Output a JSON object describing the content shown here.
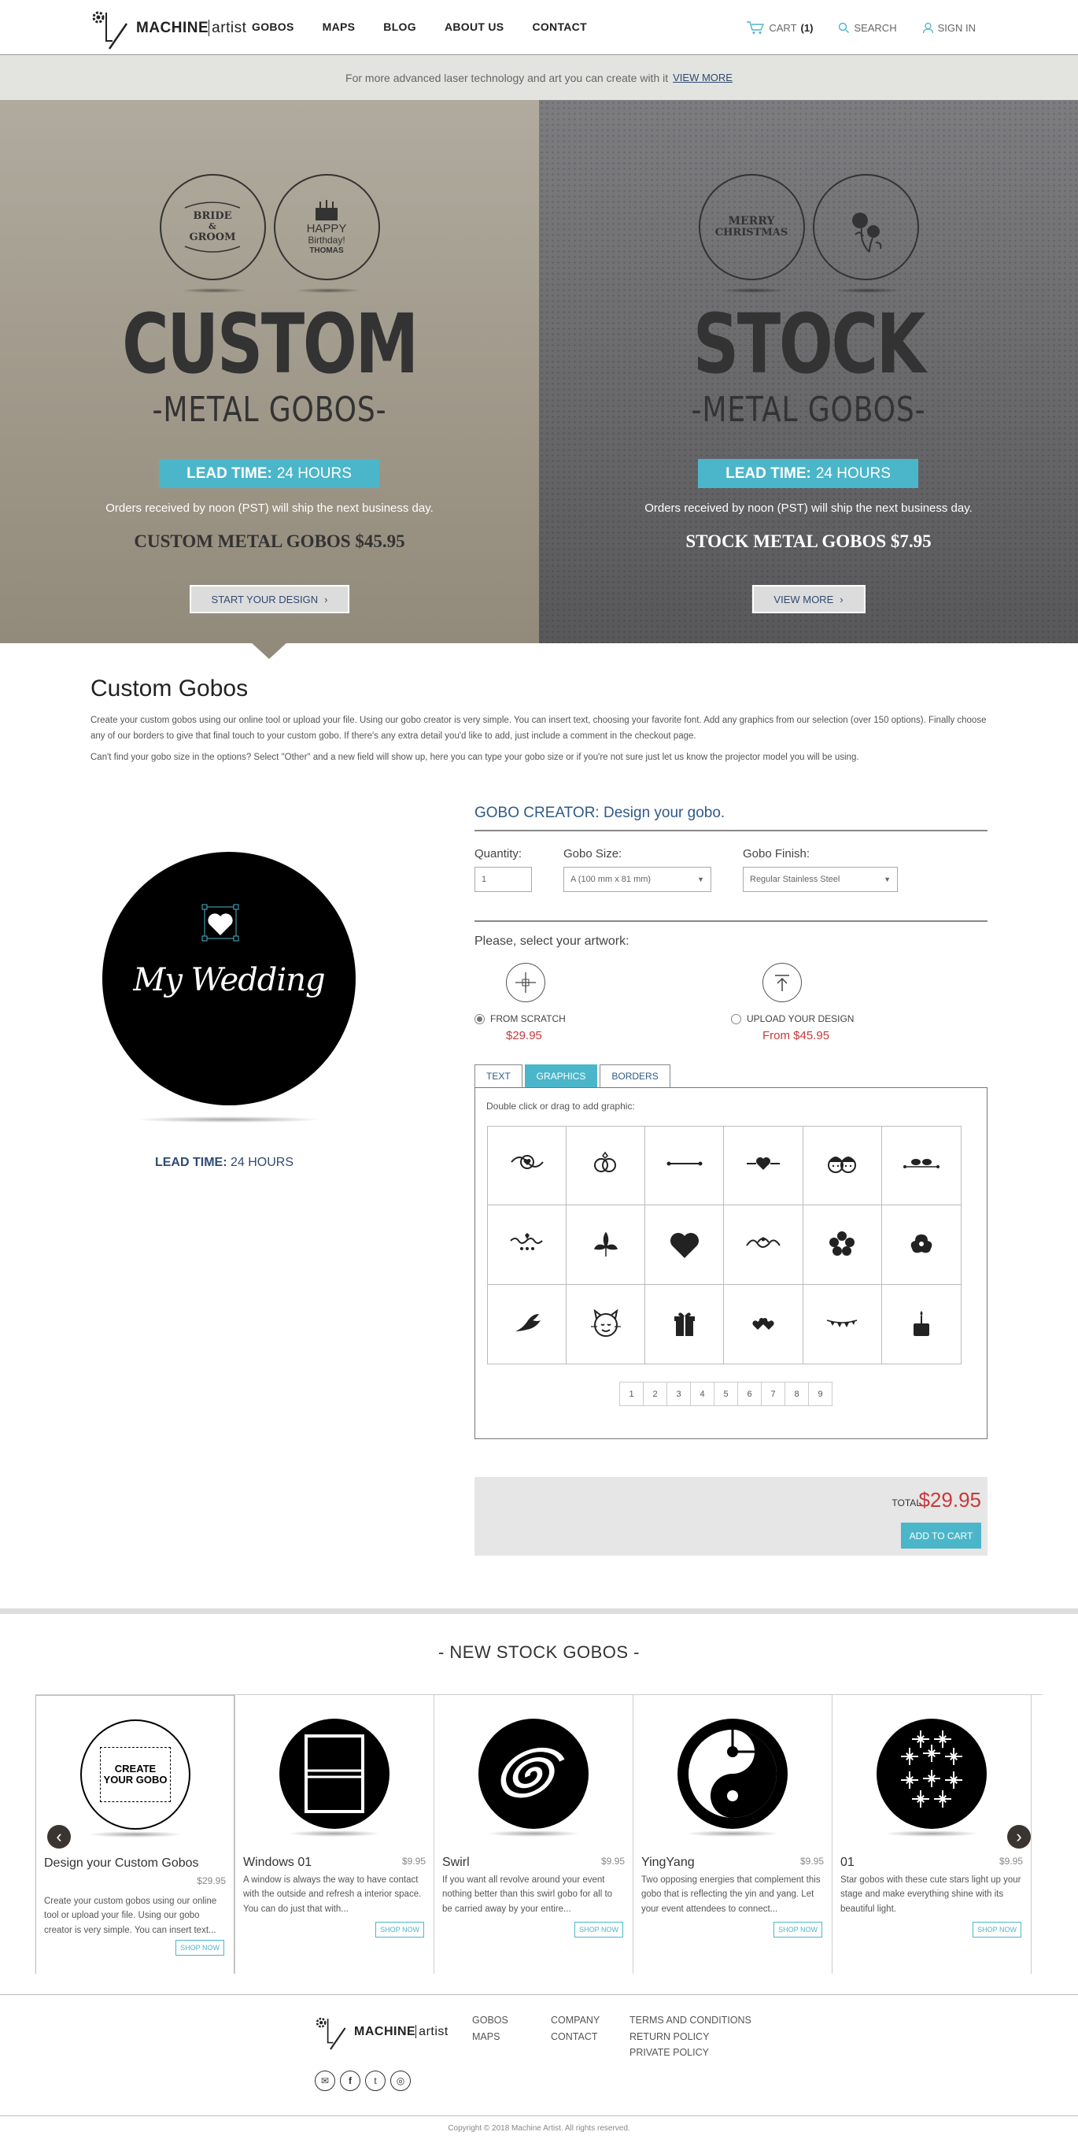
{
  "header": {
    "logo_bold": "MACHINE",
    "logo_light": "artist",
    "nav": [
      "GOBOS",
      "MAPS",
      "BLOG",
      "ABOUT US",
      "CONTACT"
    ],
    "cart_label": "CART",
    "cart_count": "(1)",
    "search_label": "SEARCH",
    "signin_label": "SIGN IN"
  },
  "promo": {
    "text": "For more advanced laser technology and art you can create with it",
    "link": "VIEW MORE"
  },
  "hero_left": {
    "seal1_line1": "BRIDE",
    "seal1_line2": "&",
    "seal1_line3": "GROOM",
    "seal2_line1": "HAPPY",
    "seal2_line2": "Birthday!",
    "seal2_line3": "THOMAS",
    "title": "CUSTOM",
    "subtitle": "-METAL GOBOS-",
    "lead_label": "LEAD TIME:",
    "lead_value": "24 HOURS",
    "shipping": "Orders received by noon (PST) will ship the next business day.",
    "price_label": "CUSTOM METAL GOBOS",
    "price": "$45.95",
    "button": "START YOUR DESIGN"
  },
  "hero_right": {
    "seal1_line1": "MERRY",
    "seal1_line2": "CHRISTMAS",
    "title": "STOCK",
    "subtitle": "-METAL GOBOS-",
    "lead_label": "LEAD TIME:",
    "lead_value": "24 HOURS",
    "shipping": "Orders received by noon (PST) will ship the next business day.",
    "price_label": "STOCK METAL GOBOS",
    "price": "$7.95",
    "button": "VIEW MORE"
  },
  "intro": {
    "title": "Custom Gobos",
    "p1": "Create your custom gobos using our online tool or upload your file. Using our gobo creator is very simple. You can insert text, choosing your favorite font. Add any graphics from our selection (over 150 options). Finally choose any of our borders to give that final touch to your custom gobo. If there's any extra detail you'd like to add, just include a comment in the checkout page.",
    "p2": "Can't find your gobo size in the options? Select \"Other\" and a new field will show up, here you can type your gobo size or if you're not sure just let us know the projector model you will be using."
  },
  "preview": {
    "text": "My Wedding",
    "lead_label": "LEAD TIME:",
    "lead_value": "24 HOURS"
  },
  "creator": {
    "title": "GOBO CREATOR: Design your gobo.",
    "quantity_label": "Quantity:",
    "quantity_value": "1",
    "size_label": "Gobo Size:",
    "size_value": "A (100 mm x 81 mm)",
    "finish_label": "Gobo Finish:",
    "finish_value": "Regular Stainless Steel",
    "artwork_label": "Please, select your artwork:",
    "opt1_label": "FROM SCRATCH",
    "opt1_price": "$29.95",
    "opt2_label": "UPLOAD YOUR DESIGN",
    "opt2_price": "From $45.95",
    "tabs": [
      "TEXT",
      "GRAPHICS",
      "BORDERS"
    ],
    "hint": "Double click or drag to add graphic:",
    "pages": [
      "1",
      "2",
      "3",
      "4",
      "5",
      "6",
      "7",
      "8",
      "9"
    ],
    "graphics": [
      "flourish-heart-icon",
      "rings-icon",
      "line-divider-icon",
      "heart-divider-icon",
      "couple-icon",
      "birds-icon",
      "ornament-icon",
      "fleur-icon",
      "heart-icon",
      "scroll-ornament-icon",
      "flower-icon",
      "hibiscus-icon",
      "dove-icon",
      "cat-icon",
      "gift-icon",
      "hearts-small-icon",
      "bunting-icon",
      "cake-icon"
    ],
    "total_label": "TOTAL",
    "total_value": "$29.95",
    "add_to_cart": "ADD TO CART"
  },
  "new_stock": {
    "title": "- NEW STOCK GOBOS -",
    "items": [
      {
        "name": "Design your Custom Gobos",
        "price": "$29.95",
        "desc": "Create your custom gobos using our online tool or upload your file. Using our gobo creator is very simple. You can insert text...",
        "button": "SHOP NOW",
        "img_line1": "CREATE",
        "img_line2": "YOUR GOBO"
      },
      {
        "name": "Windows 01",
        "price": "$9.95",
        "desc": "A window is always the way to have contact with the outside and refresh a interior space. You can do just that with...",
        "button": "SHOP NOW"
      },
      {
        "name": "Swirl",
        "price": "$9.95",
        "desc": "If you want all revolve around your event nothing better than this swirl gobo for all to be carried away by your entire...",
        "button": "SHOP NOW"
      },
      {
        "name": "YingYang",
        "price": "$9.95",
        "desc": "Two opposing energies that complement this gobo that is reflecting the yin and yang. Let your event attendees to connect...",
        "button": "SHOP NOW"
      },
      {
        "name": "01",
        "price": "$9.95",
        "desc": "Star gobos with these cute stars light up your stage and make everything shine with its beautiful light.",
        "button": "SHOP NOW"
      }
    ]
  },
  "footer": {
    "col1": [
      "GOBOS",
      "MAPS"
    ],
    "col2": [
      "COMPANY",
      "CONTACT"
    ],
    "col3": [
      "TERMS AND CONDITIONS",
      "RETURN POLICY",
      "PRIVATE POLICY"
    ],
    "copyright": "Copyright © 2018 Machine Artist. All rights reserved."
  },
  "colors": {
    "accent": "#4bb6c9",
    "navy": "#2f4a72",
    "price_red": "#c83a3a"
  }
}
